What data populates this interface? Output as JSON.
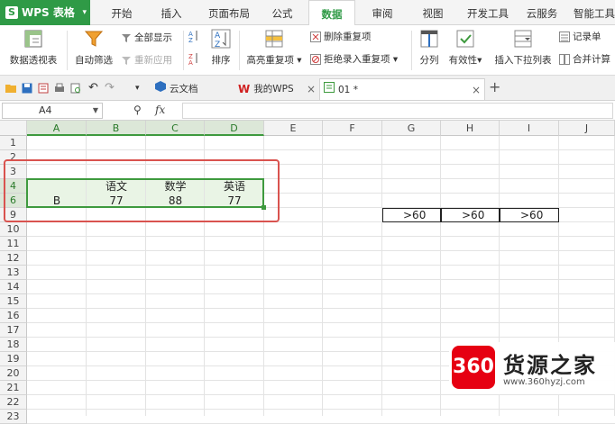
{
  "app": {
    "name": "WPS 表格",
    "logo": "S"
  },
  "menu_tabs": [
    {
      "label": "开始"
    },
    {
      "label": "插入"
    },
    {
      "label": "页面布局"
    },
    {
      "label": "公式"
    },
    {
      "label": "数据",
      "active": true
    },
    {
      "label": "审阅"
    },
    {
      "label": "视图"
    },
    {
      "label": "开发工具"
    },
    {
      "label": "云服务"
    },
    {
      "label": "智能工具"
    }
  ],
  "ribbon": {
    "pivot": "数据透视表",
    "autofilter": "自动筛选",
    "show_all": "全部显示",
    "reapply": "重新应用",
    "sort": "排序",
    "highlight_dup": "高亮重复项",
    "remove_dup": "删除重复项",
    "reject_dup": "拒绝录入重复项",
    "split": "分列",
    "validity": "有效性",
    "insert_dropdown": "插入下拉列表",
    "record_form": "记录单",
    "merge_calc": "合并计算"
  },
  "doc_tabs": [
    {
      "label": "云文档"
    },
    {
      "label": "我的WPS"
    },
    {
      "label": "01 *",
      "active": true
    }
  ],
  "formula_bar": {
    "cell_ref": "A4",
    "fx": "fx",
    "value": ""
  },
  "columns": [
    "A",
    "B",
    "C",
    "D",
    "E",
    "F",
    "G",
    "H",
    "I",
    "J"
  ],
  "rows": [
    "1",
    "2",
    "3",
    "4",
    "6",
    "9",
    "10",
    "11",
    "12",
    "13",
    "14",
    "15",
    "16",
    "17",
    "18",
    "19",
    "20",
    "21",
    "22",
    "23"
  ],
  "cells": {
    "B4": "语文",
    "C4": "数学",
    "D4": "英语",
    "A6": "B",
    "B6": "77",
    "C6": "88",
    "D6": "77",
    "G9": ">60",
    "H9": ">60",
    "I9": ">60"
  },
  "watermark": {
    "logo": "360",
    "title": "货源之家",
    "url": "www.360hyzj.com"
  },
  "colors": {
    "accent": "#2f9a46",
    "highlight_box": "#d9534f",
    "selection": "#3e9a3e"
  }
}
